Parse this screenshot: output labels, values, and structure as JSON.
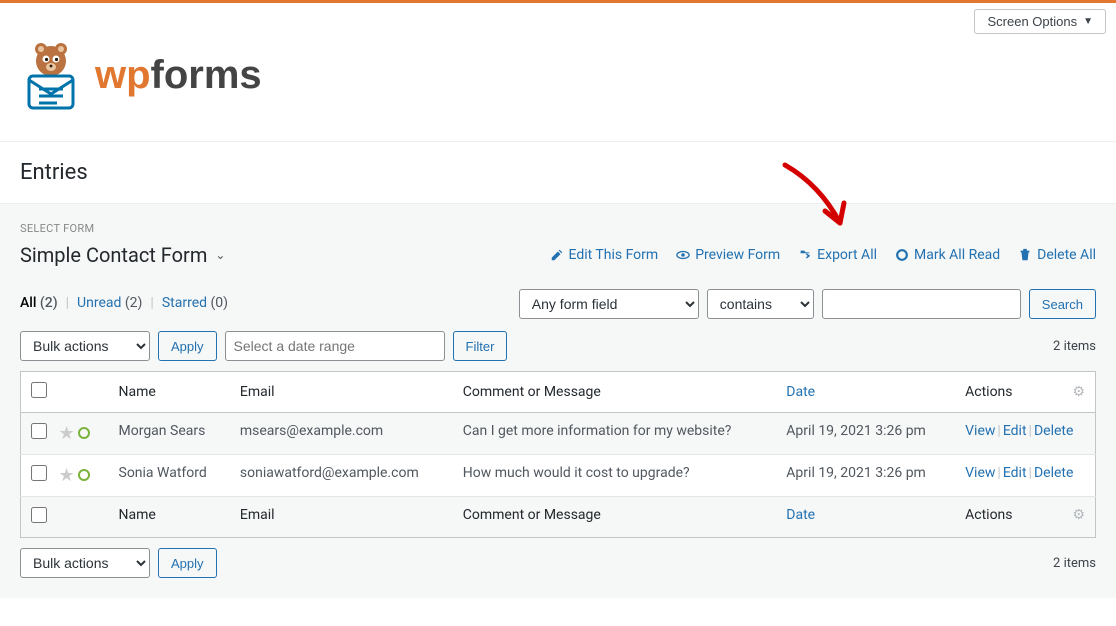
{
  "screen_options": "Screen Options",
  "page_title": "Entries",
  "select_form_label": "SELECT FORM",
  "selected_form": "Simple Contact Form",
  "actions": {
    "edit": "Edit This Form",
    "preview": "Preview Form",
    "export": "Export All",
    "mark_read": "Mark All Read",
    "delete_all": "Delete All"
  },
  "filters": {
    "all": "All",
    "all_count": "(2)",
    "unread": "Unread",
    "unread_count": "(2)",
    "starred": "Starred",
    "starred_count": "(0)"
  },
  "search": {
    "any_field": "Any form field",
    "contains": "contains",
    "search_btn": "Search"
  },
  "bulk": {
    "bulk_actions": "Bulk actions",
    "apply": "Apply",
    "date_placeholder": "Select a date range",
    "filter": "Filter"
  },
  "item_count": "2 items",
  "columns": {
    "name": "Name",
    "email": "Email",
    "message": "Comment or Message",
    "date": "Date",
    "actions": "Actions"
  },
  "rows": [
    {
      "name": "Morgan Sears",
      "email": "msears@example.com",
      "message": "Can I get more information for my website?",
      "date": "April 19, 2021 3:26 pm"
    },
    {
      "name": "Sonia Watford",
      "email": "soniawatford@example.com",
      "message": "How much would it cost to upgrade?",
      "date": "April 19, 2021 3:26 pm"
    }
  ],
  "row_actions": {
    "view": "View",
    "edit": "Edit",
    "delete": "Delete"
  }
}
